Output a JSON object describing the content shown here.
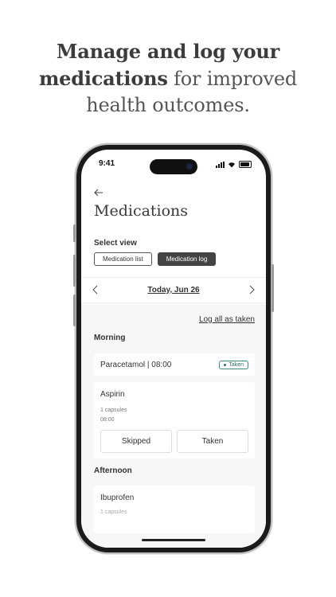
{
  "headline": {
    "strong_1": "Manage and log your",
    "strong_2": "medications",
    "light_2": " for improved",
    "light_3": "health outcomes."
  },
  "status_bar": {
    "time": "9:41"
  },
  "header": {
    "back_icon": "arrow-left-icon",
    "title": "Medications"
  },
  "view_select": {
    "label": "Select view",
    "options": [
      "Medication list",
      "Medication log"
    ],
    "selected": "Medication log"
  },
  "date_nav": {
    "label": "Today, Jun 26",
    "prev_icon": "chevron-left-icon",
    "next_icon": "chevron-right-icon"
  },
  "actions": {
    "log_all": "Log all as taken"
  },
  "sections": {
    "morning": {
      "label": "Morning",
      "taken_item": {
        "name": "Paracetamol | 08:00",
        "badge": "Taken"
      },
      "pending_item": {
        "name": "Aspirin",
        "dose": "1 capsules",
        "time": "08:00",
        "skip_label": "Skipped",
        "take_label": "Taken"
      }
    },
    "afternoon": {
      "label": "Afternoon",
      "item": {
        "name": "Ibuprofen",
        "dose": "1 capsules"
      }
    }
  },
  "colors": {
    "accent_dark": "#444444",
    "taken_green": "#2b6f65",
    "background_gray": "#f7f7f7"
  }
}
